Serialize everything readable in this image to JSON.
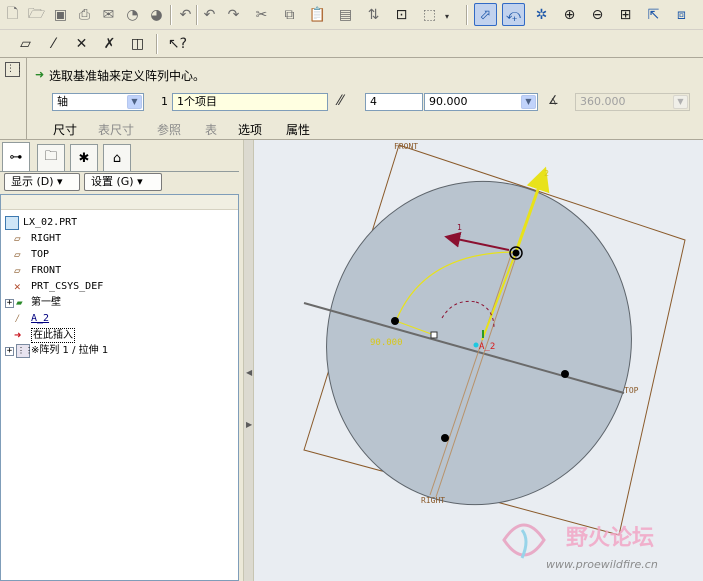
{
  "toolbar": {
    "icons": [
      "new-file-icon",
      "open-folder-icon",
      "save-icon",
      "print-icon",
      "send-mail-icon",
      "close-window-icon",
      "undo-icon",
      "redo-icon",
      "cut-icon",
      "copy-icon",
      "paste-icon",
      "paste-special-icon",
      "regenerate-icon",
      "find-icon",
      "select-box-icon",
      "datum-plane-display-icon",
      "datum-axis-display-icon",
      "datum-point-display-icon",
      "zoom-in-icon",
      "zoom-out-icon",
      "refit-icon",
      "reorient-icon",
      "saved-views-icon"
    ],
    "row2_icons": [
      "sketch-plane-icon",
      "axis-tool-icon",
      "point-tool-icon",
      "csys-tool-icon",
      "analysis-tool-icon",
      "help-whats-this-icon"
    ]
  },
  "dashboard": {
    "prompt": "选取基准轴来定义阵列中心。",
    "type_select": "轴",
    "ref_number": "1",
    "ref_value": "1个项目",
    "count_value": "4",
    "angle_value": "90.000",
    "range_value": "360.000",
    "tabs": [
      "尺寸",
      "表尺寸",
      "参照",
      "表",
      "选项",
      "属性"
    ]
  },
  "panel": {
    "show_button": "显示 (D) ▾",
    "settings_button": "设置 (G) ▾",
    "tree": [
      {
        "label": "LX_02.PRT"
      },
      {
        "label": "RIGHT"
      },
      {
        "label": "TOP"
      },
      {
        "label": "FRONT"
      },
      {
        "label": "PRT_CSYS_DEF"
      },
      {
        "label": "第一壁"
      },
      {
        "label": "A_2"
      },
      {
        "label": "在此插入"
      },
      {
        "label": "※阵列 1 / 拉伸 1"
      }
    ]
  },
  "graphics": {
    "front_label": "FRONT",
    "top_label": "TOP",
    "right_label": "RIGHT",
    "axis_label": "A_2",
    "dim_label": "90.000",
    "dir1_label": "1",
    "dir2_label": "2",
    "watermark_title": "野火论坛",
    "watermark_url": "www.proewildfire.cn"
  }
}
